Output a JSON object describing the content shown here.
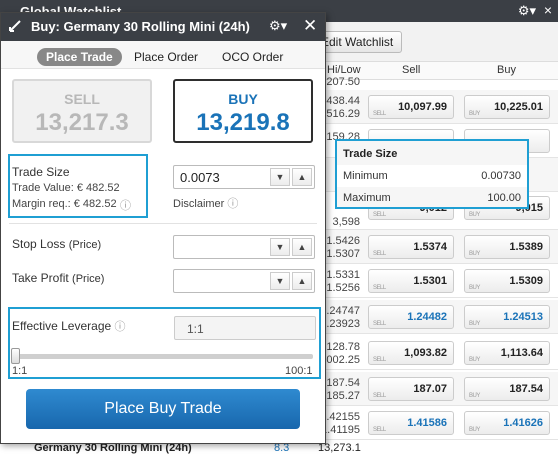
{
  "watchlist": {
    "title": "Global Watchlist",
    "gear_icon": "gear-icon",
    "close_label": "×",
    "edit_button": "Edit Watchlist",
    "columns": [
      "Hi/Low",
      "Sell",
      "Buy"
    ],
    "rows": [
      {
        "hi": "1,207.50",
        "low": "",
        "sell": "",
        "buy": ""
      },
      {
        "hi": "438.44",
        "low": "516.29",
        "sell": "10,097.99",
        "buy": "10,225.01"
      },
      {
        "hi": "159.28",
        "low": "",
        "sell": "",
        "buy": ""
      },
      {
        "hi": "7",
        "low": "",
        "sell": "",
        "buy": ""
      },
      {
        "hi": "3,598",
        "low": "",
        "sell": "9,012",
        "buy": "9,015"
      },
      {
        "hi": "1.5426",
        "low": "1.5307",
        "sell": "1.5374",
        "buy": "1.5389"
      },
      {
        "hi": "1.5331",
        "low": "1.5256",
        "sell": "1.5301",
        "buy": "1.5309"
      },
      {
        "hi": "1.24747",
        "low": "1.23923",
        "sell": "1.24482",
        "buy": "1.24513"
      },
      {
        "hi": "128.78",
        "low": "1,002.25",
        "sell": "1,093.82",
        "buy": "1,113.64"
      },
      {
        "hi": "187.54",
        "low": "185.27",
        "sell": "187.07",
        "buy": "187.54"
      },
      {
        "hi": "1.42155",
        "low": "1.41195",
        "sell": "1.41586",
        "buy": "1.41626"
      }
    ],
    "footer_name": "Germany 30 Rolling Mini (24h)",
    "footer_change": "8.3",
    "footer_hi": "13,273.1"
  },
  "dialog": {
    "title": "Buy: Germany 30 Rolling Mini (24h)",
    "gear_icon": "gear-icon",
    "close_label": "✕",
    "tabs": [
      "Place Trade",
      "Place Order",
      "OCO Order"
    ],
    "sell_label": "SELL",
    "sell_price": "13,217.3",
    "buy_label": "BUY",
    "buy_price": "13,219.8",
    "trade_size_label": "Trade Size",
    "trade_value": "Trade Value: € 482.52",
    "margin_req": "Margin req.: € 482.52",
    "trade_size_value": "0.0073",
    "disclaimer": "Disclaimer",
    "stop_loss": "Stop Loss",
    "stop_loss_suffix": "(Price)",
    "take_profit": "Take Profit",
    "take_profit_suffix": "(Price)",
    "leverage_label": "Effective Leverage",
    "leverage_value": "1:1",
    "slider_min": "1:1",
    "slider_max": "100:1",
    "slider_level": 0,
    "place_button": "Place Buy Trade",
    "colors": {
      "accent": "#1a73b8",
      "highlight": "#1f9fd3",
      "titlebar": "#3b3f45"
    }
  },
  "tooltip": {
    "title": "Trade Size",
    "min_label": "Minimum",
    "min_value": "0.00730",
    "max_label": "Maximum",
    "max_value": "100.00"
  }
}
